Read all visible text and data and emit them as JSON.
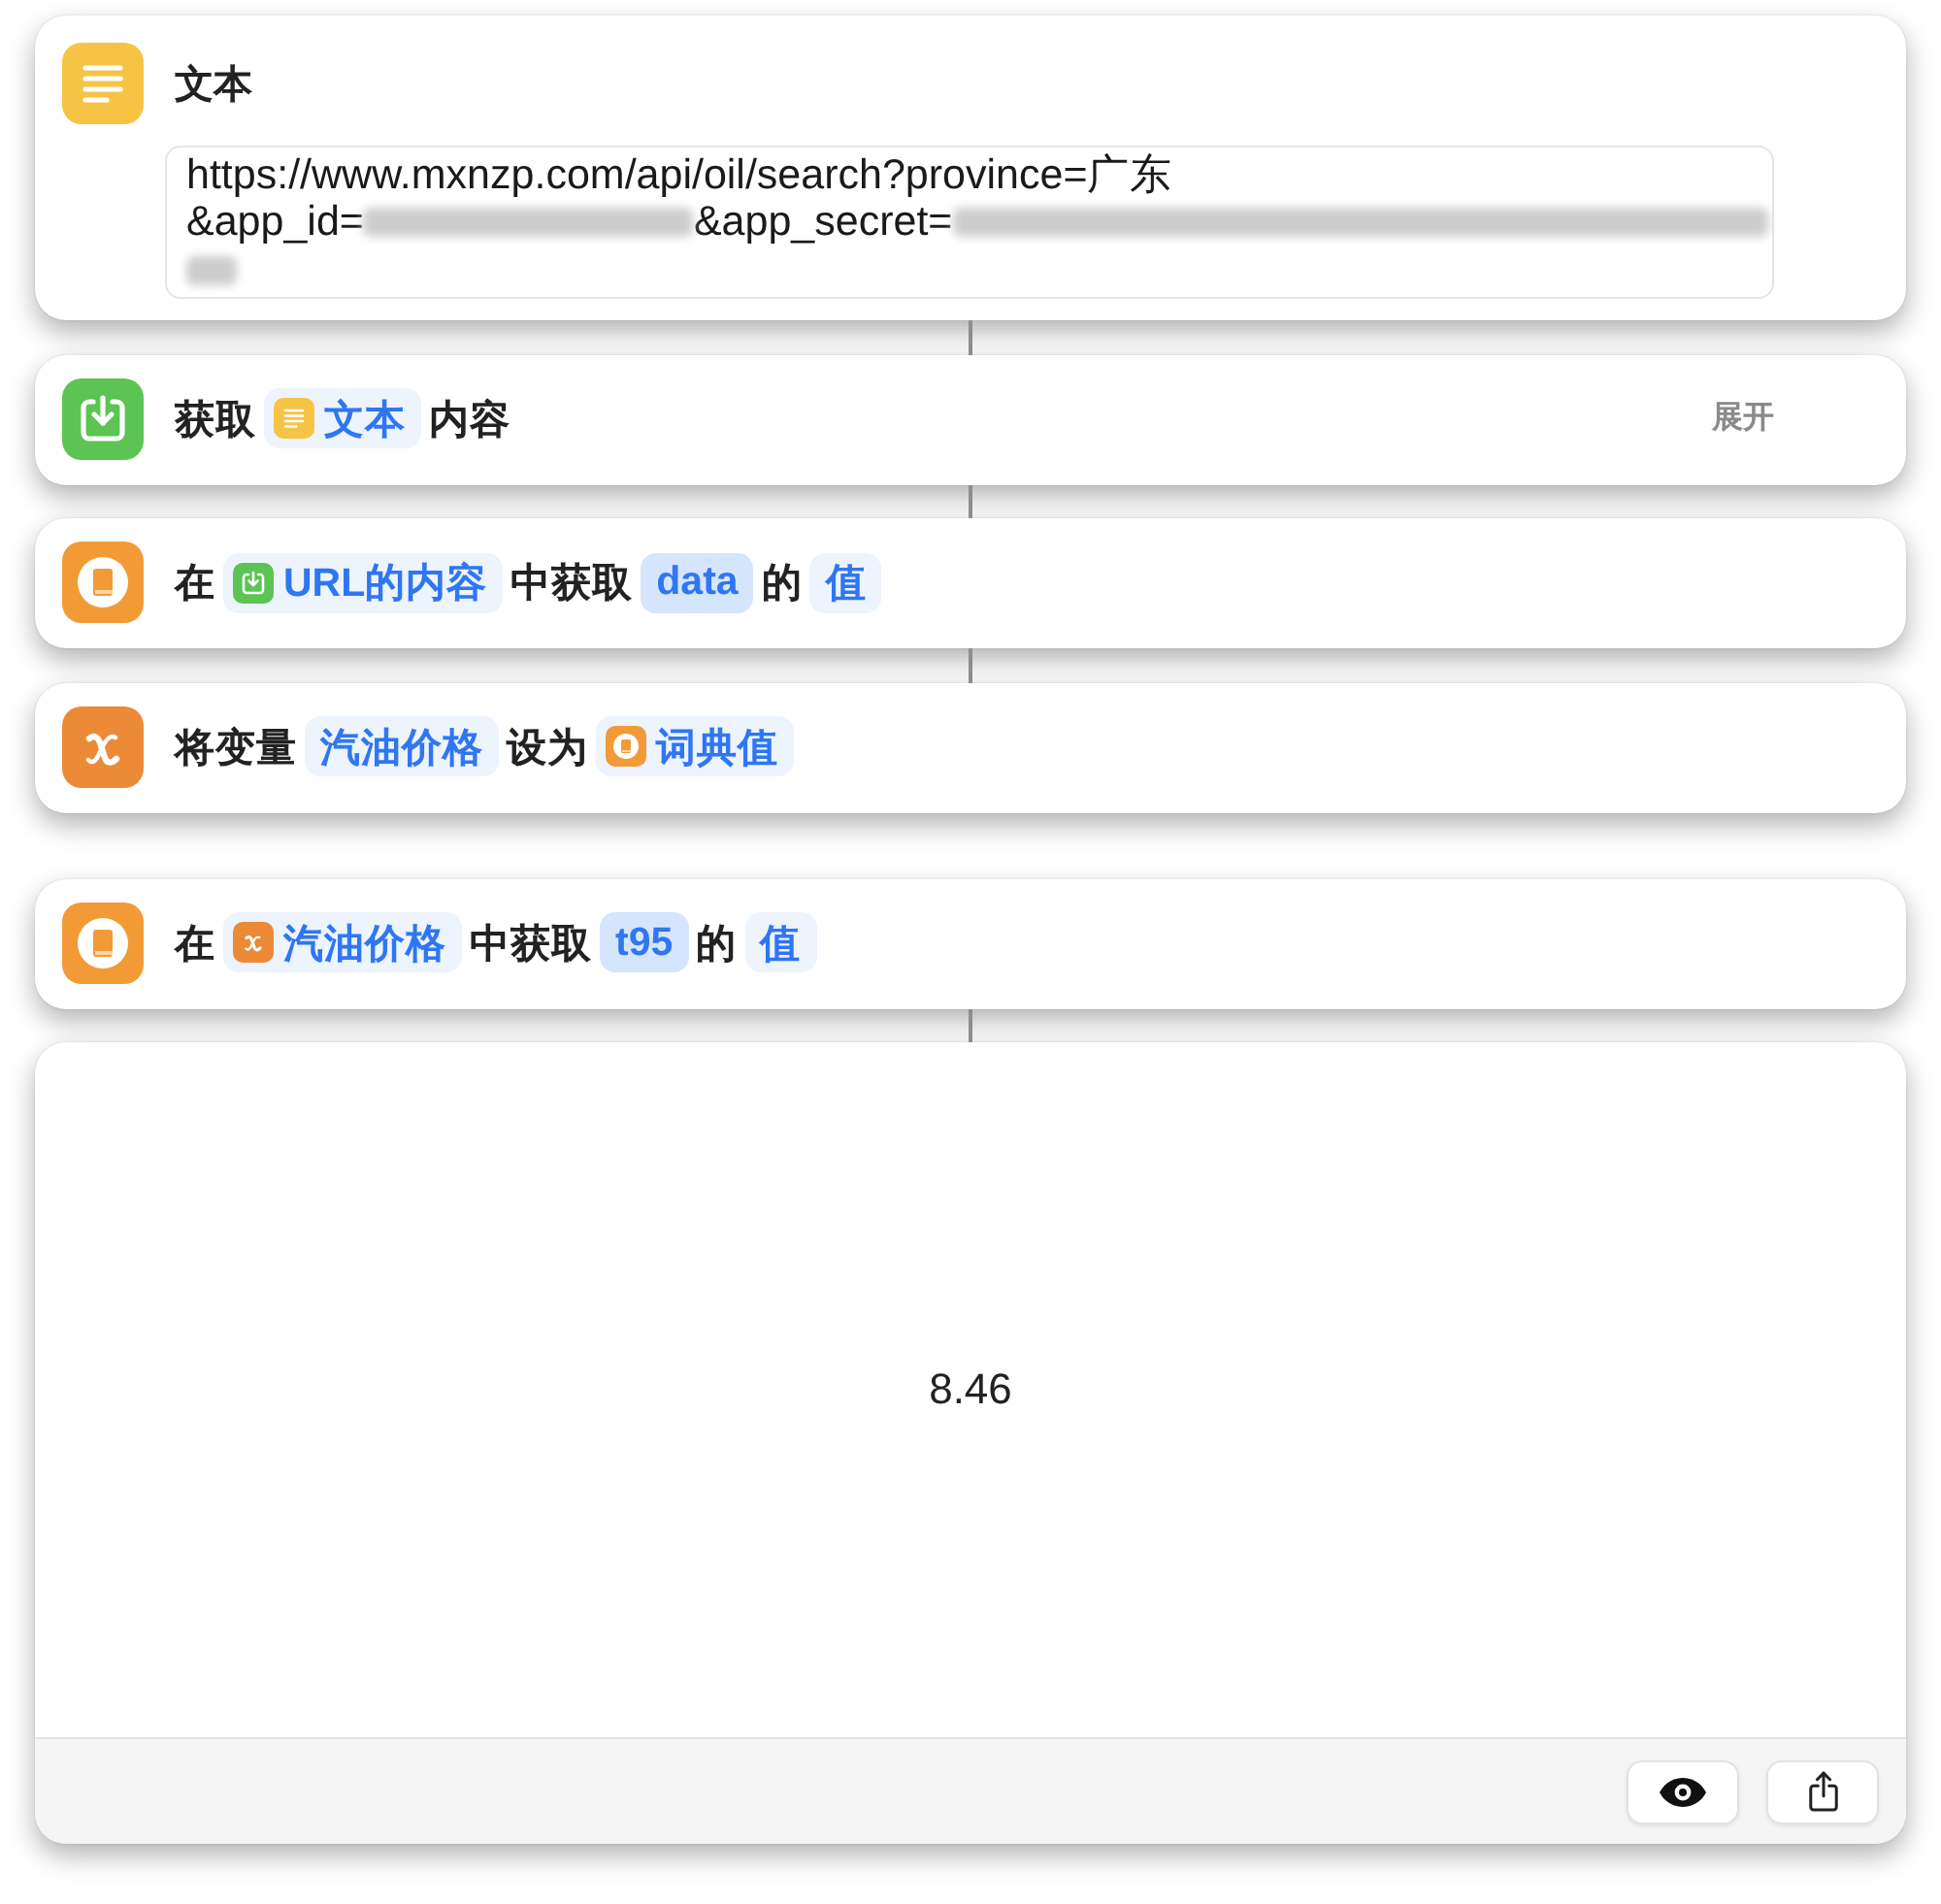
{
  "actions": [
    {
      "kind": "text",
      "linked": false,
      "title": "文本",
      "field": {
        "lines": [
          [
            {
              "kind": "typed",
              "text": "https://www.mxnzp.com/api/oil/search?province=广东"
            }
          ],
          [
            {
              "kind": "typed",
              "text": "&app_id="
            },
            {
              "kind": "redacted"
            },
            {
              "kind": "typed",
              "text": "&app_secret="
            },
            {
              "kind": "redacted"
            }
          ],
          [
            {
              "kind": "redacted"
            }
          ]
        ]
      }
    },
    {
      "kind": "download",
      "linked": true,
      "parts": [
        {
          "kind": "label",
          "text": "获取"
        },
        {
          "kind": "text",
          "text": "文本"
        },
        {
          "kind": "label",
          "text": "内容"
        }
      ],
      "expand": "展开"
    },
    {
      "kind": "dictionary",
      "linked": true,
      "parts": [
        {
          "kind": "label",
          "text": "在"
        },
        {
          "kind": "download",
          "text": "URL的内容"
        },
        {
          "kind": "label",
          "text": "中获取"
        },
        {
          "kind": "key",
          "text": "data"
        },
        {
          "kind": "label",
          "text": "的"
        },
        {
          "kind": "plain",
          "text": "值"
        }
      ]
    },
    {
      "kind": "variable",
      "linked": true,
      "parts": [
        {
          "kind": "label",
          "text": "将变量"
        },
        {
          "kind": "plain",
          "text": "汽油价格"
        },
        {
          "kind": "label",
          "text": "设为"
        },
        {
          "kind": "dictionary",
          "text": "词典值"
        }
      ]
    },
    {
      "kind": "dictionary",
      "linked": false,
      "parts": [
        {
          "kind": "label",
          "text": "在"
        },
        {
          "kind": "variable",
          "text": "汽油价格"
        },
        {
          "kind": "label",
          "text": "中获取"
        },
        {
          "kind": "key",
          "text": "t95"
        },
        {
          "kind": "label",
          "text": "的"
        },
        {
          "kind": "plain",
          "text": "值"
        }
      ]
    }
  ],
  "result": {
    "linked": true,
    "value": "8.46"
  }
}
